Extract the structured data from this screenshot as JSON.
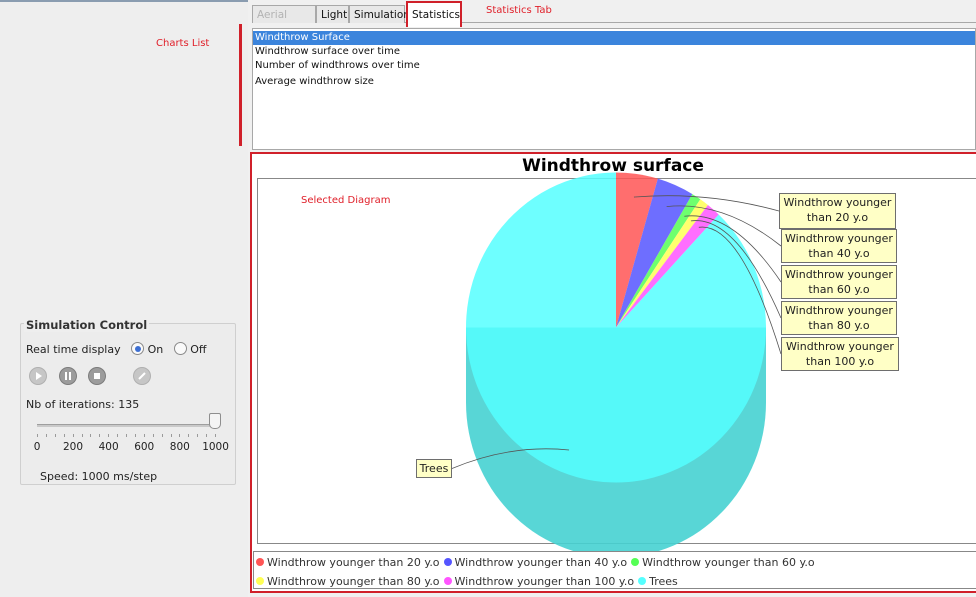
{
  "annotations": {
    "charts_list": "Charts List",
    "statistics_tab": "Statistics Tab",
    "selected_diagram": "Selected Diagram"
  },
  "tabs": [
    {
      "label": "Aerial Photo",
      "state": "disabled"
    },
    {
      "label": "Light",
      "state": "normal"
    },
    {
      "label": "Simulation",
      "state": "normal"
    },
    {
      "label": "Statistics",
      "state": "active"
    }
  ],
  "charts_list": {
    "items": [
      {
        "label": "Windthrow Surface",
        "selected": true
      },
      {
        "label": "Windthrow surface over time",
        "selected": false
      },
      {
        "label": "Number of windthrows over time",
        "selected": false
      },
      {
        "label": "Average windthrow size",
        "selected": false
      }
    ]
  },
  "simulation_control": {
    "title": "Simulation Control",
    "real_time_label": "Real time display",
    "on_label": "On",
    "off_label": "Off",
    "real_time_value": "On",
    "iterations_label": "Nb of iterations: 135",
    "slider": {
      "min": 0,
      "max": 1000,
      "value": 1000,
      "tick_labels": [
        "0",
        "200",
        "400",
        "600",
        "800",
        "1000"
      ]
    },
    "speed_label": "Speed: 1000 ms/step",
    "buttons": [
      "play-icon",
      "pause-icon",
      "stop-icon",
      "edit-icon"
    ]
  },
  "chart_data": {
    "type": "pie",
    "title": "Windthrow surface",
    "categories": [
      "Windthrow younger than 20 y.o",
      "Windthrow younger than 40 y.o",
      "Windthrow younger than 60 y.o",
      "Windthrow younger than 80 y.o",
      "Windthrow younger than 100 y.o",
      "Trees"
    ],
    "callout_labels": [
      [
        "Windthrow younger",
        "than 20 y.o"
      ],
      [
        "Windthrow younger",
        "than 40 y.o"
      ],
      [
        "Windthrow younger",
        "than 60 y.o"
      ],
      [
        "Windthrow younger",
        "than 80 y.o"
      ],
      [
        "Windthrow younger",
        "than 100 y.o"
      ],
      [
        "Trees"
      ]
    ],
    "values": [
      4.5,
      4.0,
      1.0,
      1.0,
      1.5,
      88.0
    ],
    "colors": [
      "#ff5555",
      "#5555ff",
      "#55ff55",
      "#ffff55",
      "#ff55ff",
      "#55ffff"
    ],
    "legend_placement": "bottom"
  }
}
